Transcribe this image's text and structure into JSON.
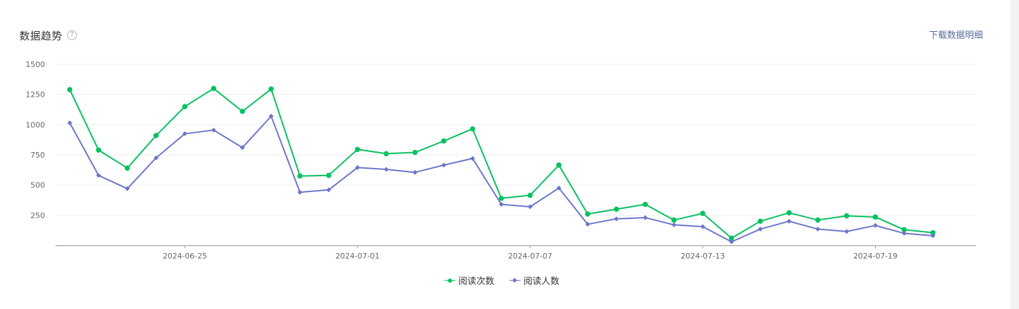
{
  "header": {
    "title": "数据趋势",
    "help_glyph": "?",
    "download_label": "下载数据明细"
  },
  "icons": {
    "help": "question-circle-icon"
  },
  "chart_data": {
    "type": "line",
    "title": "数据趋势",
    "xlabel": "",
    "ylabel": "",
    "x": [
      "2024-06-21",
      "2024-06-22",
      "2024-06-23",
      "2024-06-24",
      "2024-06-25",
      "2024-06-26",
      "2024-06-27",
      "2024-06-28",
      "2024-06-29",
      "2024-06-30",
      "2024-07-01",
      "2024-07-02",
      "2024-07-03",
      "2024-07-04",
      "2024-07-05",
      "2024-07-06",
      "2024-07-07",
      "2024-07-08",
      "2024-07-09",
      "2024-07-10",
      "2024-07-11",
      "2024-07-12",
      "2024-07-13",
      "2024-07-14",
      "2024-07-15",
      "2024-07-16",
      "2024-07-17",
      "2024-07-18",
      "2024-07-19",
      "2024-07-20",
      "2024-07-21",
      "2024-07-22"
    ],
    "x_tick_labels": [
      "2024-06-25",
      "2024-07-01",
      "2024-07-07",
      "2024-07-13",
      "2024-07-19"
    ],
    "y_ticks": [
      250,
      500,
      750,
      1000,
      1250,
      1500
    ],
    "ylim": [
      0,
      1500
    ],
    "grid": true,
    "legend_position": "bottom-center",
    "series": [
      {
        "name": "阅读次数",
        "color": "#07c160",
        "marker": "circle",
        "values": [
          1290,
          790,
          640,
          910,
          1150,
          1300,
          1110,
          1295,
          575,
          580,
          795,
          760,
          770,
          865,
          965,
          390,
          415,
          665,
          260,
          300,
          340,
          210,
          265,
          60,
          200,
          270,
          210,
          245,
          235,
          130,
          105
        ]
      },
      {
        "name": "阅读人数",
        "color": "#6b76cb",
        "marker": "diamond",
        "values": [
          1015,
          580,
          470,
          725,
          925,
          955,
          810,
          1070,
          440,
          460,
          645,
          630,
          605,
          665,
          720,
          340,
          320,
          475,
          175,
          220,
          230,
          170,
          155,
          30,
          135,
          200,
          135,
          115,
          165,
          100,
          80
        ]
      }
    ]
  }
}
